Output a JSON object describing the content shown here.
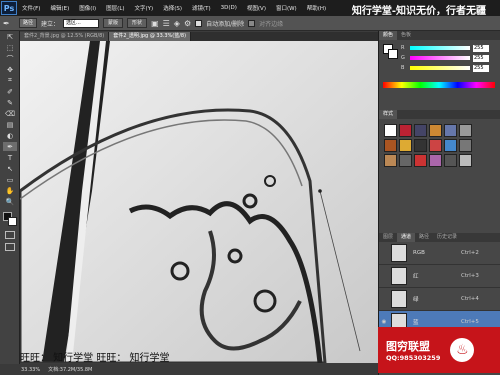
{
  "app": {
    "logo": "Ps",
    "menus": [
      "文件(F)",
      "编辑(E)",
      "图像(I)",
      "图层(L)",
      "文字(Y)",
      "选择(S)",
      "滤镜(T)",
      "3D(D)",
      "视图(V)",
      "窗口(W)",
      "帮助(H)"
    ],
    "watermark": "知行学堂-知识无价，行者无疆"
  },
  "options": {
    "tool_mode": "路径",
    "build_label": "建立：",
    "build_value": "选区...",
    "mask_btn": "蒙版",
    "shape_btn": "形状",
    "auto_add_label": "自动添加/删除",
    "align_edges_label": "对齐边缘"
  },
  "tabs": [
    {
      "label": "套件2_背景.jpg @ 12.5% (RGB/8)"
    },
    {
      "label": "套件2_透明.jpg @ 33.3%(蓝/8)"
    }
  ],
  "tools": [
    "⇱",
    "⬚",
    "⌒",
    "✥",
    "⌗",
    "✐",
    "✎",
    "⌫",
    "▤",
    "◐",
    "✋",
    "T",
    "↖",
    "▭",
    "✋",
    "🔍"
  ],
  "canvas": {
    "caption": "旺旺：  知行学堂    旺旺：  知行学堂"
  },
  "status": {
    "zoom": "33.33%",
    "doc": "文档:37.2M/35.8M"
  },
  "color_panel": {
    "tabs": [
      "颜色",
      "色板"
    ],
    "r_label": "R",
    "g_label": "G",
    "b_label": "B",
    "r": "255",
    "g": "255",
    "b": "255"
  },
  "styles_panel": {
    "tab": "样式"
  },
  "channels_panel": {
    "tabs": [
      "图层",
      "通道",
      "路径",
      "历史记录"
    ],
    "channels": [
      {
        "name": "RGB",
        "key": "Ctrl+2"
      },
      {
        "name": "红",
        "key": "Ctrl+3"
      },
      {
        "name": "绿",
        "key": "Ctrl+4"
      },
      {
        "name": "蓝",
        "key": "Ctrl+5"
      }
    ]
  },
  "promo": {
    "title": "图穷联盟",
    "qq": "QQ:985303259"
  }
}
